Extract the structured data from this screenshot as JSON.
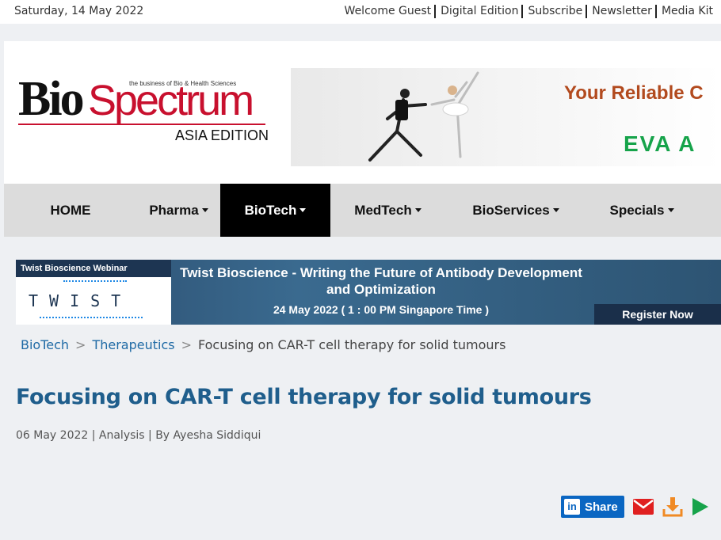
{
  "topbar": {
    "date": "Saturday, 14 May 2022",
    "links": [
      "Welcome Guest",
      "Digital Edition",
      "Subscribe",
      "Newsletter",
      "Media Kit"
    ]
  },
  "logo": {
    "bio": "Bio",
    "spectrum": "Spectrum",
    "tagline": "the business of Bio & Health Sciences",
    "edition": "ASIA EDITION"
  },
  "ad": {
    "title": "Your Reliable C",
    "brand": "EVA A"
  },
  "nav": {
    "items": [
      {
        "label": "HOME",
        "dropdown": false
      },
      {
        "label": "Pharma",
        "dropdown": true
      },
      {
        "label": "BioTech",
        "dropdown": true
      },
      {
        "label": "MedTech",
        "dropdown": true
      },
      {
        "label": "BioServices",
        "dropdown": true
      },
      {
        "label": "Specials",
        "dropdown": true
      }
    ],
    "active": "BioTech"
  },
  "webinar": {
    "label": "Twist Bioscience Webinar",
    "logo_text": "TWIST",
    "title": "Twist Bioscience - Writing the Future of Antibody Development and Optimization",
    "date": "24 May 2022 ( 1 : 00 PM Singapore Time )",
    "cta": "Register Now"
  },
  "breadcrumb": {
    "items": [
      "BioTech",
      "Therapeutics",
      "Focusing on CAR-T cell therapy for solid tumours"
    ]
  },
  "article": {
    "title": "Focusing on CAR-T cell therapy for solid tumours",
    "meta": "06 May 2022 | Analysis | By Ayesha Siddiqui"
  },
  "share": {
    "linkedin_icon": "in",
    "label": "Share"
  },
  "colors": {
    "brand_red": "#c8102e",
    "link_blue": "#1f6aa5",
    "title_blue": "#1f5e8c",
    "linkedin": "#0a66c2"
  }
}
